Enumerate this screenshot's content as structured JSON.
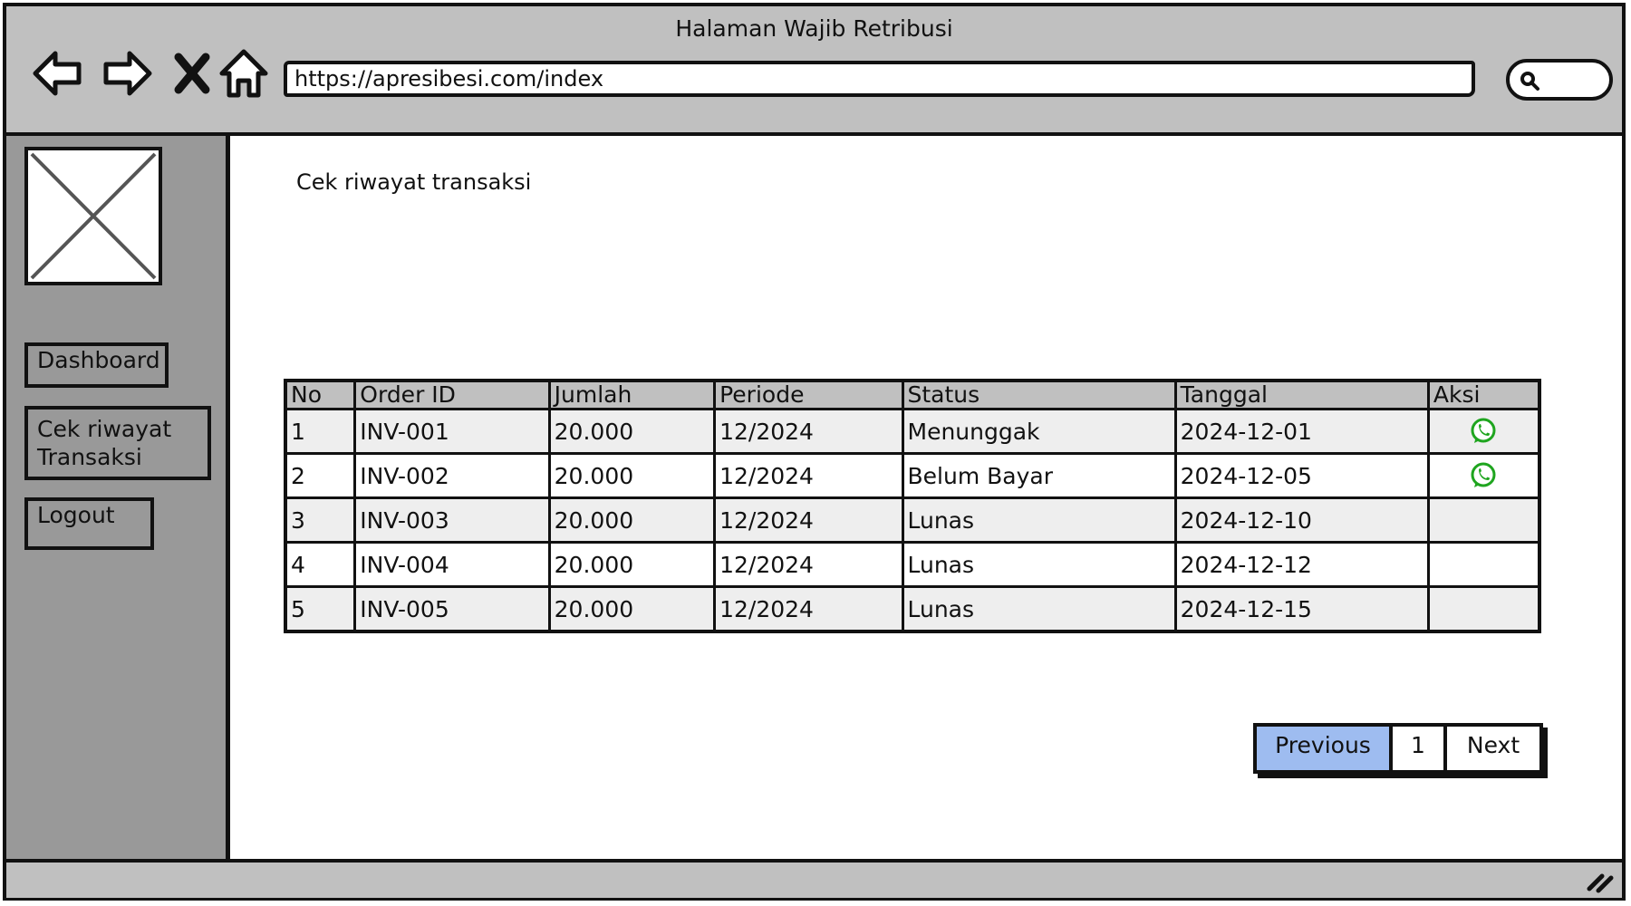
{
  "window": {
    "title": "Halaman Wajib Retribusi"
  },
  "browser": {
    "url": "https://apresibesi.com/index",
    "nav_icons": [
      "back-arrow-icon",
      "forward-arrow-icon",
      "close-icon",
      "home-icon"
    ],
    "search_icon": "search-icon"
  },
  "sidebar": {
    "logo": "image-placeholder-icon",
    "items": [
      {
        "label": "Dashboard"
      },
      {
        "label": "Cek riwayat\nTransaksi"
      },
      {
        "label": "Logout"
      }
    ]
  },
  "main": {
    "heading": "Cek riwayat transaksi",
    "table": {
      "columns": [
        "No",
        "Order ID",
        "Jumlah",
        "Periode",
        "Status",
        "Tanggal",
        "Aksi"
      ],
      "rows": [
        {
          "no": "1",
          "order_id": "INV-001",
          "jumlah": "20.000",
          "periode": "12/2024",
          "status": "Menunggak",
          "tanggal": "2024-12-01",
          "aksi_icon": "whatsapp-icon"
        },
        {
          "no": "2",
          "order_id": "INV-002",
          "jumlah": "20.000",
          "periode": "12/2024",
          "status": "Belum Bayar",
          "tanggal": "2024-12-05",
          "aksi_icon": "whatsapp-icon"
        },
        {
          "no": "3",
          "order_id": "INV-003",
          "jumlah": "20.000",
          "periode": "12/2024",
          "status": "Lunas",
          "tanggal": "2024-12-10",
          "aksi_icon": ""
        },
        {
          "no": "4",
          "order_id": "INV-004",
          "jumlah": "20.000",
          "periode": "12/2024",
          "status": "Lunas",
          "tanggal": "2024-12-12",
          "aksi_icon": ""
        },
        {
          "no": "5",
          "order_id": "INV-005",
          "jumlah": "20.000",
          "periode": "12/2024",
          "status": "Lunas",
          "tanggal": "2024-12-15",
          "aksi_icon": ""
        }
      ]
    },
    "pagination": {
      "previous": "Previous",
      "current": "1",
      "next": "Next"
    }
  },
  "colors": {
    "chrome": "#c0c0c0",
    "sidebar": "#999999",
    "row_alt": "#eeeeee",
    "pagination_active": "#9ebcf0",
    "whatsapp": "#1fa51f"
  }
}
